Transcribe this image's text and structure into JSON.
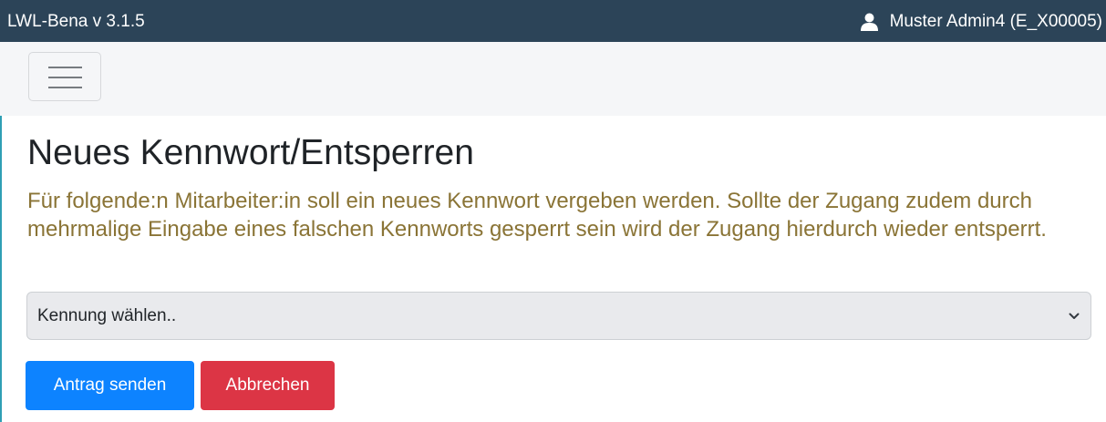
{
  "header": {
    "app_title": "LWL-Bena v 3.1.5",
    "user_icon": "user-icon",
    "user_label": "Muster Admin4 (E_X00005)"
  },
  "nav": {
    "menu_icon": "hamburger-menu-icon"
  },
  "main": {
    "title": "Neues Kennwort/Entsperren",
    "description": "Für folgende:n Mitarbeiter:in soll ein neues Kennwort vergeben werden. Sollte der Zugang zudem durch mehrmalige Eingabe eines falschen Kennworts gesperrt sein wird der Zugang hierdurch wieder entsperrt.",
    "select": {
      "selected": "Kennung wählen..",
      "icon": "chevron-down-icon"
    },
    "buttons": {
      "submit_label": "Antrag senden",
      "cancel_label": "Abbrechen"
    }
  },
  "colors": {
    "topbar": "#2c4458",
    "description_text": "#8a7436",
    "primary": "#0d83ff",
    "danger": "#dc3545"
  }
}
